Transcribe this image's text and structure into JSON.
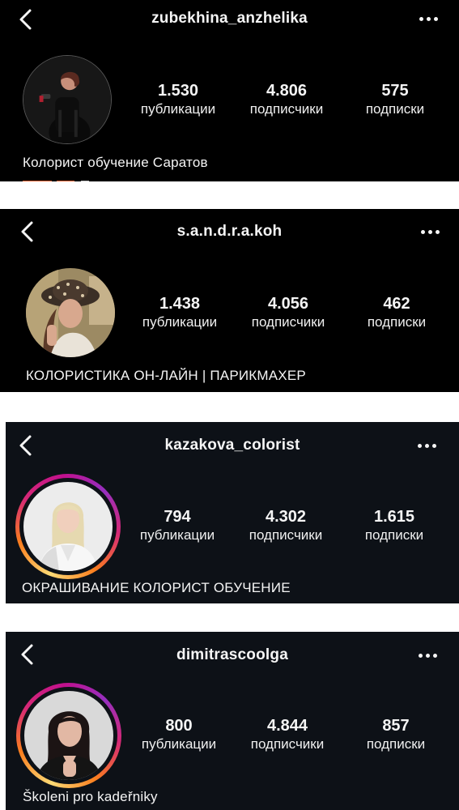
{
  "colors": {
    "background_dark": "#000000",
    "background_navy": "#0d1117",
    "text": "#f5f5f5",
    "link_orange": "#e8683a"
  },
  "icons": {
    "back": "chevron-left-icon",
    "more": "more-horizontal-icon"
  },
  "profiles": [
    {
      "username": "zubekhina_anzhelika",
      "stats": [
        {
          "value": "1.530",
          "label": "публикации"
        },
        {
          "value": "4.806",
          "label": "подписчики"
        },
        {
          "value": "575",
          "label": "подписки"
        }
      ],
      "bio": "Колорист обучение Саратов"
    },
    {
      "username": "s.a.n.d.r.a.koh",
      "stats": [
        {
          "value": "1.438",
          "label": "публикации"
        },
        {
          "value": "4.056",
          "label": "подписчики"
        },
        {
          "value": "462",
          "label": "подписки"
        }
      ],
      "bio": "КОЛОРИСТИКА ОН-ЛАЙН | ПАРИКМАХЕР"
    },
    {
      "username": "kazakova_colorist",
      "stats": [
        {
          "value": "794",
          "label": "публикации"
        },
        {
          "value": "4.302",
          "label": "подписчики"
        },
        {
          "value": "1.615",
          "label": "подписки"
        }
      ],
      "bio": "ОКРАШИВАНИЕ КОЛОРИСТ ОБУЧЕНИЕ"
    },
    {
      "username": "dimitrascoolga",
      "stats": [
        {
          "value": "800",
          "label": "публикации"
        },
        {
          "value": "4.844",
          "label": "подписчики"
        },
        {
          "value": "857",
          "label": "подписки"
        }
      ],
      "bio": "Školeni pro kadeřniky"
    }
  ]
}
